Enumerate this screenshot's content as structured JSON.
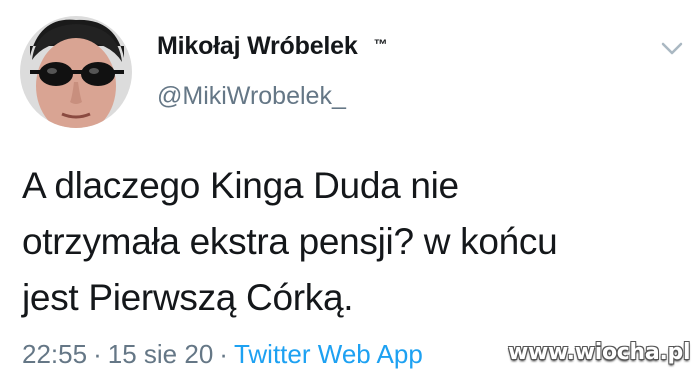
{
  "user": {
    "display_name": "Mikołaj Wróbelek",
    "badge": "™",
    "handle": "@MikiWrobelek_"
  },
  "tweet": {
    "lines": [
      "A dlaczego Kinga Duda nie",
      "otrzymała ekstra pensji? w końcu",
      "jest Pierwszą Córką."
    ],
    "time": "22:55",
    "date": "15 sie 20",
    "separator": "·",
    "source": "Twitter Web App"
  },
  "watermark": "www.wiocha.pl",
  "icons": {
    "avatar": "avatar-photo",
    "menu": "chevron-down-icon"
  },
  "colors": {
    "text": "#14171a",
    "secondary": "#657786",
    "link": "#1da1f2"
  }
}
